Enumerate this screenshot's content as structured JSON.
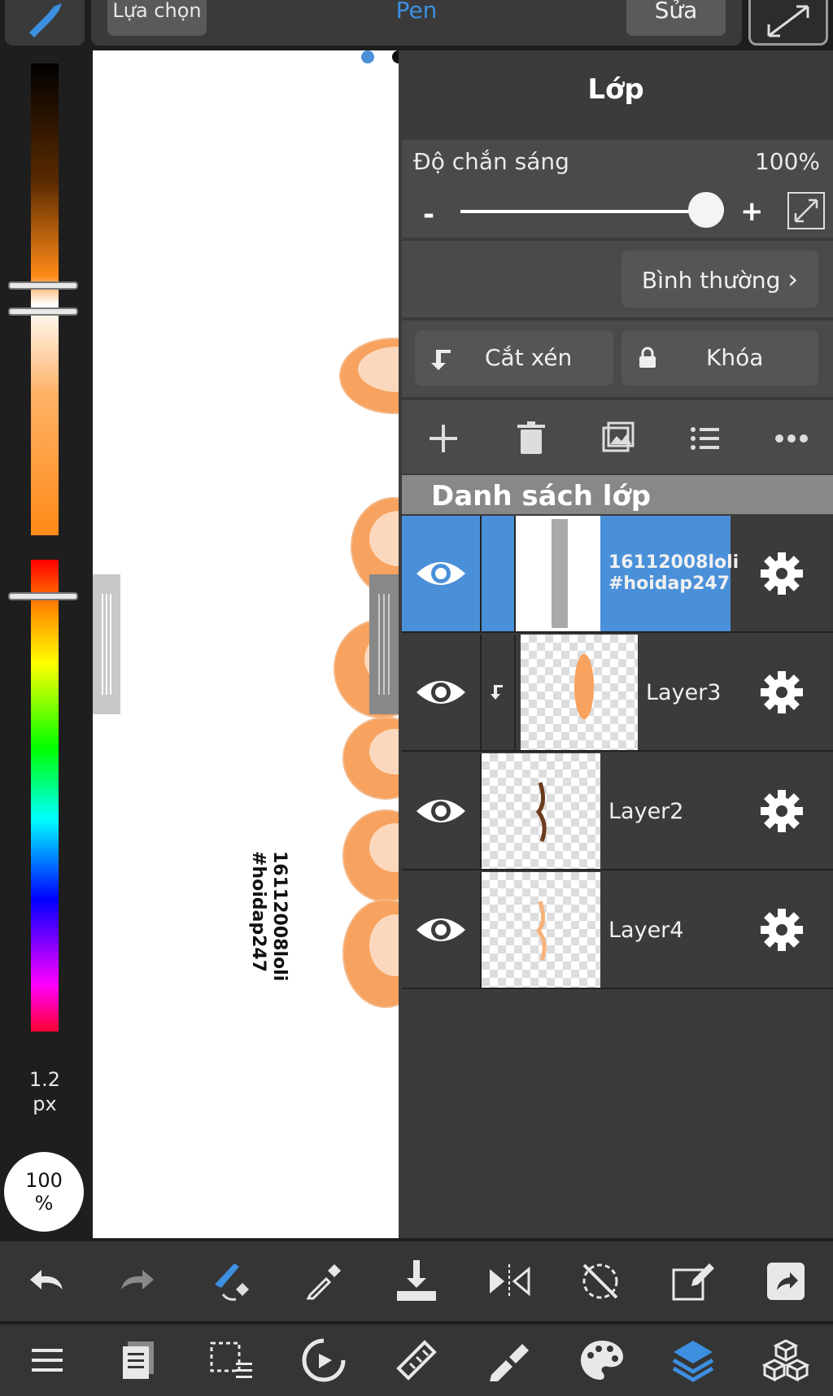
{
  "topbar": {
    "selection_label": "Lựa chọn",
    "tool_name": "Pen",
    "edit_label": "Sửa"
  },
  "left_panel": {
    "brush_size_value": "1.2",
    "brush_size_unit": "px",
    "zoom_value": "100",
    "zoom_unit": "%"
  },
  "canvas": {
    "watermark_line1": "16112008loli",
    "watermark_line2": "#hoidap247"
  },
  "layers_panel": {
    "title": "Lớp",
    "opacity_label": "Độ chắn sáng",
    "opacity_value": "100%",
    "opacity_fraction": 1.0,
    "minus_label": "-",
    "plus_label": "+",
    "blend_mode": "Bình thường",
    "clip_label": "Cắt xén",
    "lock_label": "Khóa",
    "list_header": "Danh sách lớp",
    "layers": [
      {
        "name": "16112008loli #hoidap247",
        "name_line1": "16112008loli",
        "name_line2": "#hoidap247",
        "selected": true,
        "visible": true,
        "clipped": false
      },
      {
        "name": "Layer3",
        "selected": false,
        "visible": true,
        "clipped": true
      },
      {
        "name": "Layer2",
        "selected": false,
        "visible": true,
        "clipped": false
      },
      {
        "name": "Layer4",
        "selected": false,
        "visible": true,
        "clipped": false
      }
    ]
  },
  "toolbar_row1": [
    "undo-icon",
    "redo-icon",
    "brush-transform-icon",
    "eyedropper-icon",
    "download-icon",
    "flip-icon",
    "rotate-lock-icon",
    "edit-export-icon",
    "share-icon"
  ],
  "toolbar_row2": [
    "menu-icon",
    "pages-icon",
    "selection-icon",
    "rotate-icon",
    "ruler-icon",
    "fill-brush-icon",
    "palette-icon",
    "layers-icon",
    "material-icon"
  ],
  "colors": {
    "accent": "#4a90d9",
    "panel": "#3b3b3b",
    "panel_section": "#4a4a4a",
    "toolbar": "#353535"
  }
}
